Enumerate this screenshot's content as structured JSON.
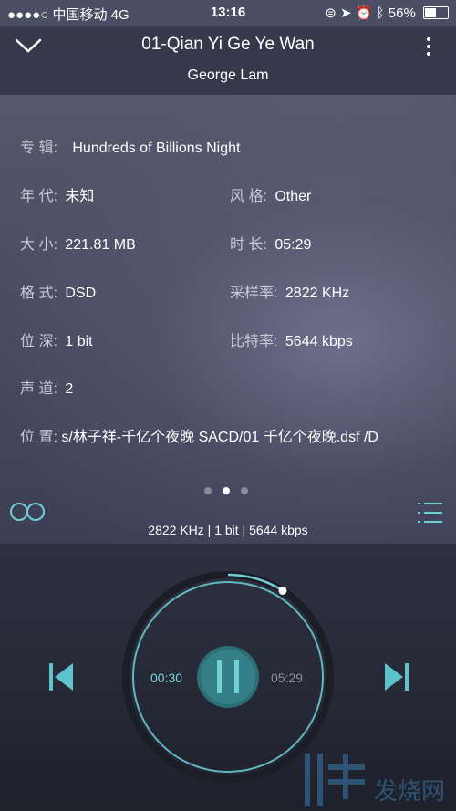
{
  "status_bar": {
    "carrier": "●●●●○ 中国移动  4G",
    "time": "13:16",
    "battery": "56%",
    "battery_level": 0.56
  },
  "header": {
    "title": "01-Qian Yi Ge Ye Wan",
    "artist": "George Lam"
  },
  "info": {
    "album_label": "专  辑:",
    "album_value": "Hundreds of Billions Night",
    "year_label": "年  代:",
    "year_value": "未知",
    "genre_label": "风  格:",
    "genre_value": "Other",
    "size_label": "大  小:",
    "size_value": "221.81 MB",
    "length_label": "时  长:",
    "length_value": "05:29",
    "format_label": "格  式:",
    "format_value": "DSD",
    "samplerate_label": "采样率:",
    "samplerate_value": "2822 KHz",
    "bitdepth_label": "位  深:",
    "bitdepth_value": "1 bit",
    "bitrate_label": "比特率:",
    "bitrate_value": "5644 kbps",
    "channels_label": "声  道:",
    "channels_value": "2",
    "path_label": "位  置:",
    "path_value": "s/林子祥-千亿个夜晚 SACD/01  千亿个夜晚.dsf  /D"
  },
  "pager": {
    "count": 3,
    "active_index": 1
  },
  "format_line": "2822 KHz | 1 bit | 5644 kbps",
  "player": {
    "current_time": "00:30",
    "duration": "05:29",
    "progress": 0.09
  },
  "watermark": "发烧网"
}
